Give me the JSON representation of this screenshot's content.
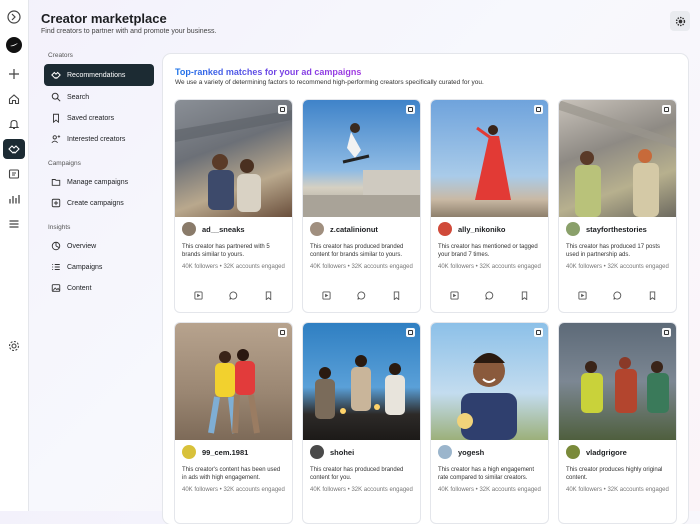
{
  "header": {
    "title": "Creator marketplace",
    "subtitle": "Find creators to partner with and promote your business."
  },
  "rail": {
    "icons": [
      "logo-icon",
      "brand-icon",
      "plus-icon",
      "home-icon",
      "bell-icon",
      "handshake-icon",
      "ads-icon",
      "chart-icon",
      "menu-icon",
      "settings-icon"
    ]
  },
  "nav": {
    "creators_label": "Creators",
    "campaigns_label": "Campaigns",
    "insights_label": "Insights",
    "items": {
      "recommendations": "Recommendations",
      "search": "Search",
      "saved": "Saved creators",
      "interested": "Interested creators",
      "manage": "Manage campaigns",
      "create": "Create campaigns",
      "overview": "Overview",
      "campaigns": "Campaigns",
      "content": "Content"
    }
  },
  "main": {
    "title": "Top-ranked matches for your ad campaigns",
    "subtitle": "We use a variety of determining factors to recommend high-performing creators specifically curated for you."
  },
  "accent_color": "#7b3fe4",
  "creators": [
    {
      "handle": "ad__sneaks",
      "desc": "This creator has partnered with 5 brands similar to yours.",
      "stats": "40K followers • 32K accounts engaged"
    },
    {
      "handle": "z.catalinionut",
      "desc": "This creator has produced branded content for brands similar to yours.",
      "stats": "40K followers • 32K accounts engaged"
    },
    {
      "handle": "ally_nikoniko",
      "desc": "This creator has mentioned or tagged your brand 7 times.",
      "stats": "40K followers • 32K accounts engaged"
    },
    {
      "handle": "stayforthestories",
      "desc": "This creator has produced 17 posts used in partnership ads.",
      "stats": "40K followers • 32K accounts engaged"
    },
    {
      "handle": "99_cem.1981",
      "desc": "This creator's content has been used in ads with high engagement.",
      "stats": "40K followers • 32K accounts engaged"
    },
    {
      "handle": "shohei",
      "desc": "This creator has produced branded content for you.",
      "stats": "40K followers • 32K accounts engaged"
    },
    {
      "handle": "yogesh",
      "desc": "This creator has a high engagement rate compared to similar creators.",
      "stats": "40K followers • 32K accounts engaged"
    },
    {
      "handle": "vladgrigore",
      "desc": "This creator produces highly original content.",
      "stats": "40K followers • 32K accounts engaged"
    }
  ]
}
